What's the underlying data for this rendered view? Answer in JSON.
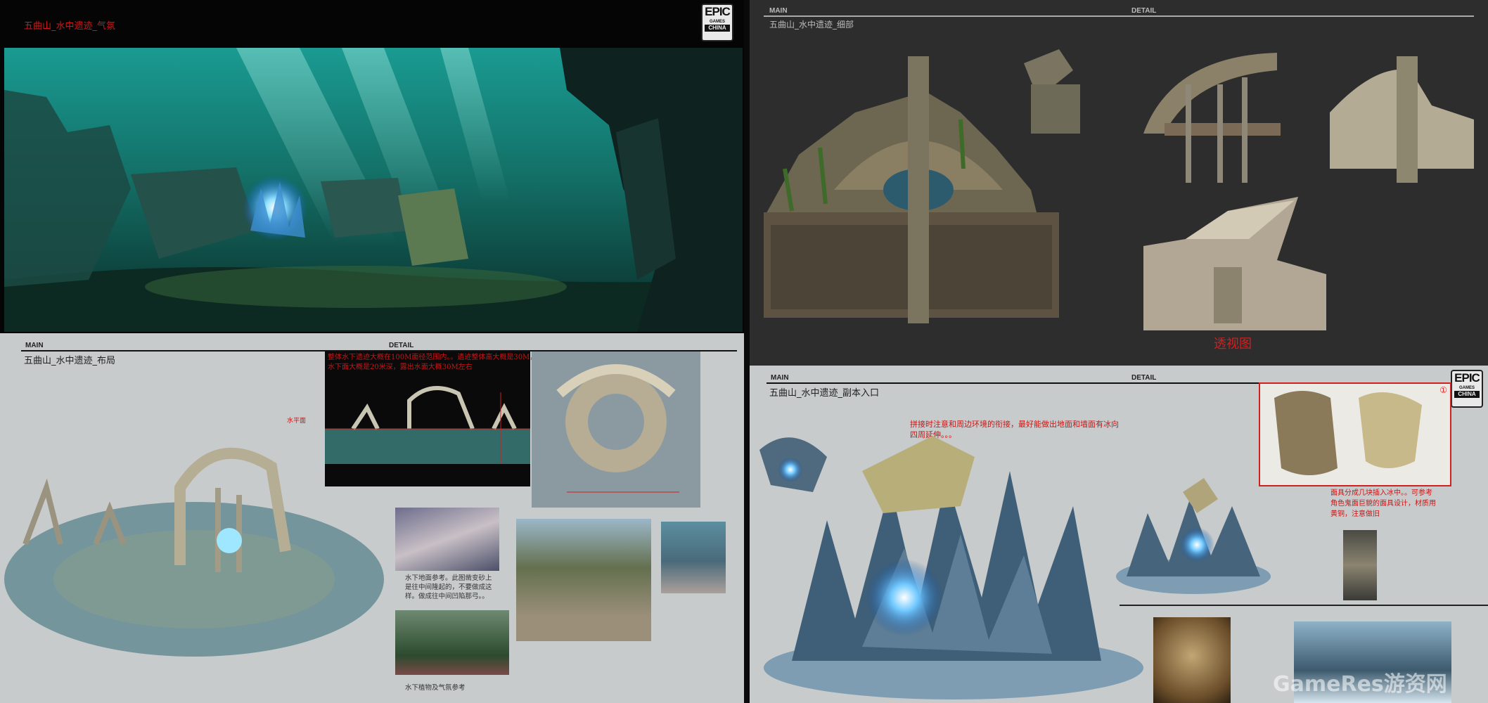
{
  "atmosphere_panel": {
    "title": "五曲山_水中遗迹_气氛"
  },
  "logo": {
    "line1": "EPIC",
    "line2": "GAMES",
    "line3": "CHINA"
  },
  "detail_panel": {
    "header_main": "MAIN",
    "header_detail": "DETAIL",
    "title": "五曲山_水中遗迹_细部",
    "perspective_label": "透视图"
  },
  "layout_panel": {
    "header_main": "MAIN",
    "header_detail": "DETAIL",
    "title": "五曲山_水中遗迹_布局",
    "red_note": "整体水下遗迹大概在100M面径范围内。。遗迹整体高大概是30M，淹没在水下面大概是20米深，露出水面大概30M左右",
    "water_label": "水平面",
    "ref_note_1": "水下地面参考。此图凿变砂上是往中间隆起的，不要做成这样。做成往中间凹陷那弓。。",
    "ref_note_2": "水下植物及气氛参考"
  },
  "entrance_panel": {
    "header_main": "MAIN",
    "header_detail": "DETAIL",
    "title": "五曲山_水中遗迹_副本入口",
    "red_note_1": "拼接时注意和周边环境的衔接，最好能做出地面和墙面有冰向四周延伸。。。",
    "red_note_2": "面具分成几块插入冰中。。可参考角色鬼面巨貌的面具设计，材质用黄铜，注意做旧",
    "badge": "①"
  },
  "watermark": {
    "text": "GameRes游资网"
  },
  "colors": {
    "title_red": "#d01818",
    "water_teal": "#1f8a86",
    "ice_blue": "#6fc8ff"
  }
}
